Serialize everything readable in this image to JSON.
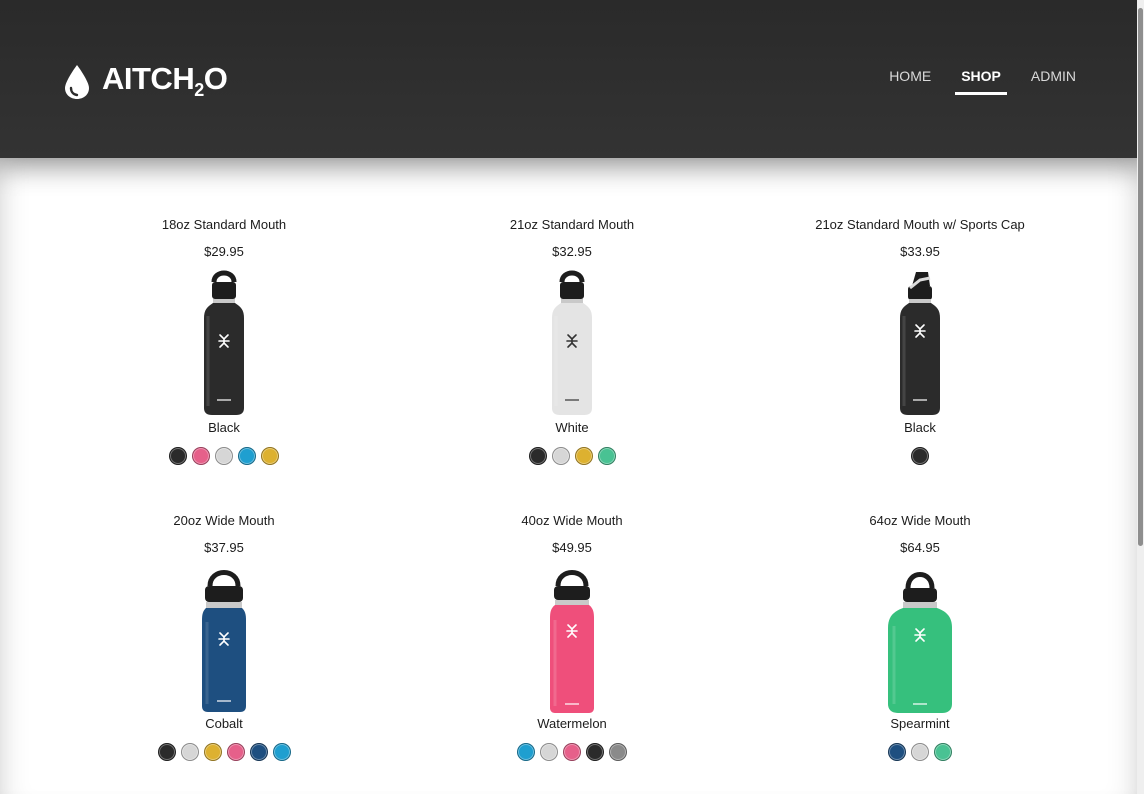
{
  "brand": {
    "text": "AITCH",
    "sub": "2",
    "suffix": "O"
  },
  "nav": [
    {
      "label": "HOME",
      "active": false
    },
    {
      "label": "SHOP",
      "active": true
    },
    {
      "label": "ADMIN",
      "active": false
    }
  ],
  "products": [
    {
      "name": "18oz Standard Mouth",
      "price": "$29.95",
      "color_name": "Black",
      "bottle_color": "#2b2b2b",
      "style": "standard",
      "swatches": [
        "#2b2b2b",
        "#e6608a",
        "#d6d6d6",
        "#1f9fd0",
        "#ddb130"
      ]
    },
    {
      "name": "21oz Standard Mouth",
      "price": "$32.95",
      "color_name": "White",
      "bottle_color": "#e4e4e4",
      "style": "standard",
      "swatches": [
        "#2b2b2b",
        "#d6d6d6",
        "#ddb130",
        "#49c293"
      ]
    },
    {
      "name": "21oz Standard Mouth w/ Sports Cap",
      "price": "$33.95",
      "color_name": "Black",
      "bottle_color": "#2b2b2b",
      "style": "sport",
      "swatches": [
        "#2b2b2b"
      ]
    },
    {
      "name": "20oz Wide Mouth",
      "price": "$37.95",
      "color_name": "Cobalt",
      "bottle_color": "#1e4f80",
      "style": "wide",
      "swatches": [
        "#2b2b2b",
        "#d6d6d6",
        "#ddb130",
        "#e6608a",
        "#1e4f80",
        "#1f9fd0"
      ]
    },
    {
      "name": "40oz Wide Mouth",
      "price": "$49.95",
      "color_name": "Watermelon",
      "bottle_color": "#ef4f7b",
      "style": "wide-tall",
      "swatches": [
        "#1f9fd0",
        "#d6d6d6",
        "#e6608a",
        "#2b2b2b",
        "#8a8a8a"
      ]
    },
    {
      "name": "64oz Wide Mouth",
      "price": "$64.95",
      "color_name": "Spearmint",
      "bottle_color": "#36c07d",
      "style": "growler",
      "swatches": [
        "#1e4f80",
        "#d6d6d6",
        "#49c293"
      ]
    }
  ]
}
